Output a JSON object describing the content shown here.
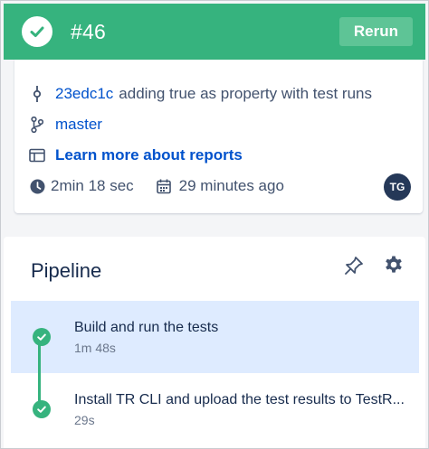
{
  "header": {
    "build_number": "#46",
    "rerun_label": "Rerun",
    "status": "success",
    "status_color": "#36b37e"
  },
  "info": {
    "commit_hash": "23edc1c",
    "commit_message": "adding true as property with test runs",
    "branch": "master",
    "reports_link": "Learn more about reports",
    "duration": "2min 18 sec",
    "started": "29 minutes ago",
    "avatar_initials": "TG"
  },
  "pipeline": {
    "title": "Pipeline",
    "steps": [
      {
        "name": "Build and run the tests",
        "duration": "1m 48s",
        "status": "success",
        "selected": true
      },
      {
        "name": "Install TR CLI and upload the test results to TestR...",
        "duration": "29s",
        "status": "success",
        "selected": false
      }
    ]
  },
  "colors": {
    "success": "#36b37e",
    "link": "#0052cc",
    "selected_row": "#deebff",
    "avatar": "#253858"
  },
  "icons": [
    "check-icon",
    "commit-icon",
    "branch-icon",
    "reports-icon",
    "clock-icon",
    "calendar-icon",
    "pin-icon",
    "gear-icon"
  ]
}
